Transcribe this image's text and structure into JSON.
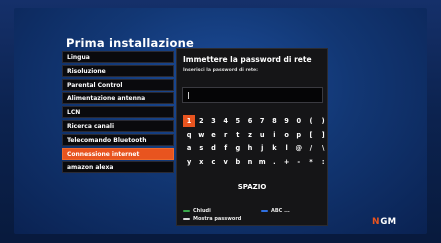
{
  "setup": {
    "title": "Prima installazione",
    "menu": [
      {
        "label": "Lingua",
        "active": false
      },
      {
        "label": "Risoluzione",
        "active": false
      },
      {
        "label": "Parental Control",
        "active": false
      },
      {
        "label": "Alimentazione antenna",
        "active": false
      },
      {
        "label": "LCN",
        "active": false
      },
      {
        "label": "Ricerca canali",
        "active": false
      },
      {
        "label": "Telecomando Bluetooth",
        "active": false
      },
      {
        "label": "Connessione internet",
        "active": true
      },
      {
        "label": "amazon alexa",
        "active": false
      }
    ]
  },
  "dialog": {
    "title": "Immettere la password di rete",
    "subtitle": "Inserisci la password di rete:",
    "password_value": "",
    "keyboard_rows": [
      [
        "1",
        "2",
        "3",
        "4",
        "5",
        "6",
        "7",
        "8",
        "9",
        "0",
        "(",
        ")"
      ],
      [
        "q",
        "w",
        "e",
        "r",
        "t",
        "z",
        "u",
        "i",
        "o",
        "p",
        "[",
        "]"
      ],
      [
        "a",
        "s",
        "d",
        "f",
        "g",
        "h",
        "j",
        "k",
        "l",
        "@",
        "/",
        "\\"
      ],
      [
        "y",
        "x",
        "c",
        "v",
        "b",
        "n",
        "m",
        ".",
        "+",
        "-",
        "*",
        ":"
      ]
    ],
    "selected_key": "1",
    "space_label": "SPAZIO",
    "legend": {
      "close": {
        "label": "Chiudi",
        "color": "#3aa84a"
      },
      "abc": {
        "label": "ABC ...",
        "color": "#2f6fe0"
      },
      "show_password": {
        "label": "Mostra password",
        "color": "#d8d8d8"
      }
    }
  },
  "brand": {
    "logo_first": "N",
    "logo_rest": "GM",
    "accent": "#e8541f"
  }
}
